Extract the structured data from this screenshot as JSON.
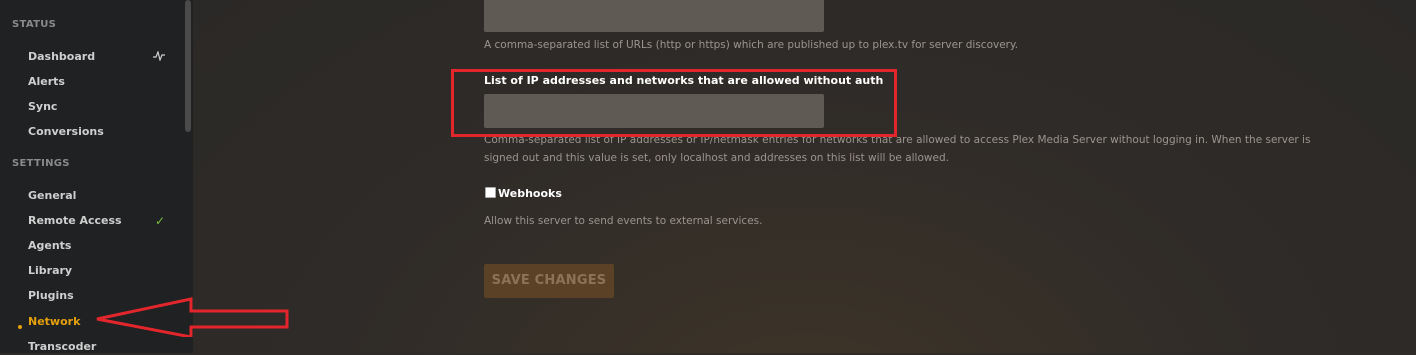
{
  "sidebar": {
    "status_header": "STATUS",
    "settings_header": "SETTINGS",
    "status_items": [
      {
        "label": "Dashboard",
        "icon": "pulse-icon"
      },
      {
        "label": "Alerts"
      },
      {
        "label": "Sync"
      },
      {
        "label": "Conversions"
      }
    ],
    "settings_items": [
      {
        "label": "General"
      },
      {
        "label": "Remote Access",
        "icon": "check-icon"
      },
      {
        "label": "Agents"
      },
      {
        "label": "Library"
      },
      {
        "label": "Plugins"
      },
      {
        "label": "Network",
        "active": true
      },
      {
        "label": "Transcoder"
      }
    ]
  },
  "main": {
    "custom_urls_help": "A comma-separated list of URLs (http or https) which are published up to plex.tv for server discovery.",
    "allowed_networks_label": "List of IP addresses and networks that are allowed without auth",
    "allowed_networks_value": "",
    "allowed_networks_help_line1": "Comma-separated list of IP addresses or IP/netmask entries for networks that are allowed to access Plex Media Server without logging in. When the server is",
    "allowed_networks_help_line2": "signed out and this value is set, only localhost and addresses on this list will be allowed.",
    "webhooks_label": "Webhooks",
    "webhooks_checked": false,
    "webhooks_help": "Allow this server to send events to external services.",
    "save_label": "SAVE CHANGES"
  },
  "colors": {
    "accent": "#e5a00d",
    "annotation_red": "#e2262c",
    "check_green": "#7ac142"
  }
}
